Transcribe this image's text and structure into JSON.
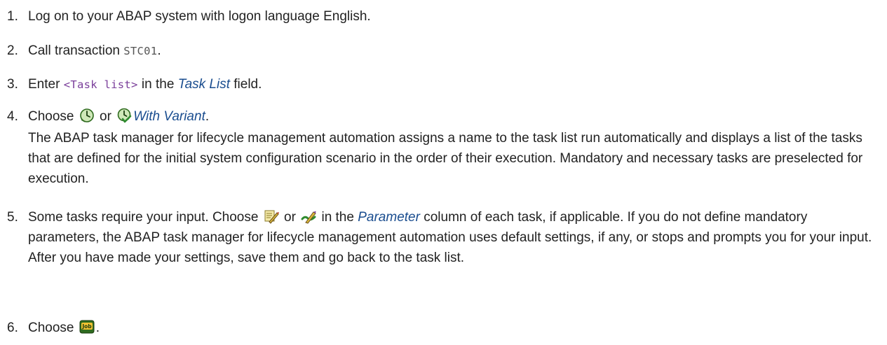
{
  "steps": [
    {
      "number": "1.",
      "text": "Log on to your ABAP system with logon language English."
    },
    {
      "number": "2.",
      "pre": "Call transaction ",
      "code": "STC01",
      "post": "."
    },
    {
      "number": "3.",
      "pre": "Enter ",
      "code": "<Task list>",
      "mid": " in the ",
      "ui": "Task List",
      "post": " field."
    },
    {
      "number": "4.",
      "pre": "Choose ",
      "mid": " or ",
      "ui": "With Variant",
      "post": ".",
      "description": "The ABAP task manager for lifecycle management automation assigns a name to the task list run automatically and displays a list of the tasks that are defined for the initial system configuration scenario in the order of their execution. Mandatory and necessary tasks are preselected for execution.",
      "icons": [
        "execute-clock-icon",
        "execute-variant-icon"
      ]
    },
    {
      "number": "5.",
      "pre": "Some tasks require your input. Choose ",
      "mid": " or ",
      "mid2": " in the ",
      "ui": "Parameter",
      "post": " column of each task, if applicable. If you do not define mandatory parameters, the ABAP task manager for lifecycle management automation uses default settings, if any, or stops and prompts you for your input. After you have made your settings, save them and go back to the task list.",
      "icons": [
        "edit-parameter-icon",
        "edit-parameter-set-icon"
      ]
    },
    {
      "number": "6.",
      "pre": "Choose ",
      "post": ".",
      "icons": [
        "job-icon"
      ]
    }
  ],
  "colors": {
    "text": "#222222",
    "ui_term": "#1a4d8f",
    "code": "#555555",
    "code_placeholder": "#7a3e9a"
  }
}
